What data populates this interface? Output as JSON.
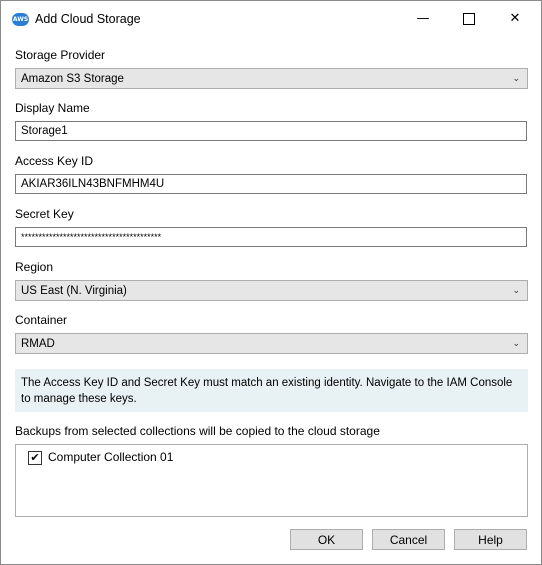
{
  "window": {
    "title": "Add Cloud Storage",
    "icon_text": "AWS",
    "minimize_glyph": "—",
    "close_glyph": "✕"
  },
  "form": {
    "storage_provider": {
      "label": "Storage Provider",
      "value": "Amazon S3 Storage"
    },
    "display_name": {
      "label": "Display Name",
      "value": "Storage1"
    },
    "access_key_id": {
      "label": "Access Key ID",
      "value": "AKIAR36ILN43BNFMHM4U"
    },
    "secret_key": {
      "label": "Secret Key",
      "value": "****************************************"
    },
    "region": {
      "label": "Region",
      "value": "US East (N. Virginia)"
    },
    "container": {
      "label": "Container",
      "value": "RMAD"
    }
  },
  "info_text": "The Access Key ID and Secret Key must match an existing identity. Navigate to the IAM Console to manage these keys.",
  "collections": {
    "label": "Backups from selected collections will be copied to the cloud storage",
    "items": [
      {
        "label": "Computer Collection 01",
        "checked": true,
        "check_glyph": "✔"
      }
    ]
  },
  "buttons": {
    "ok": "OK",
    "cancel": "Cancel",
    "help": "Help"
  },
  "dropdown_glyph": "⌄"
}
